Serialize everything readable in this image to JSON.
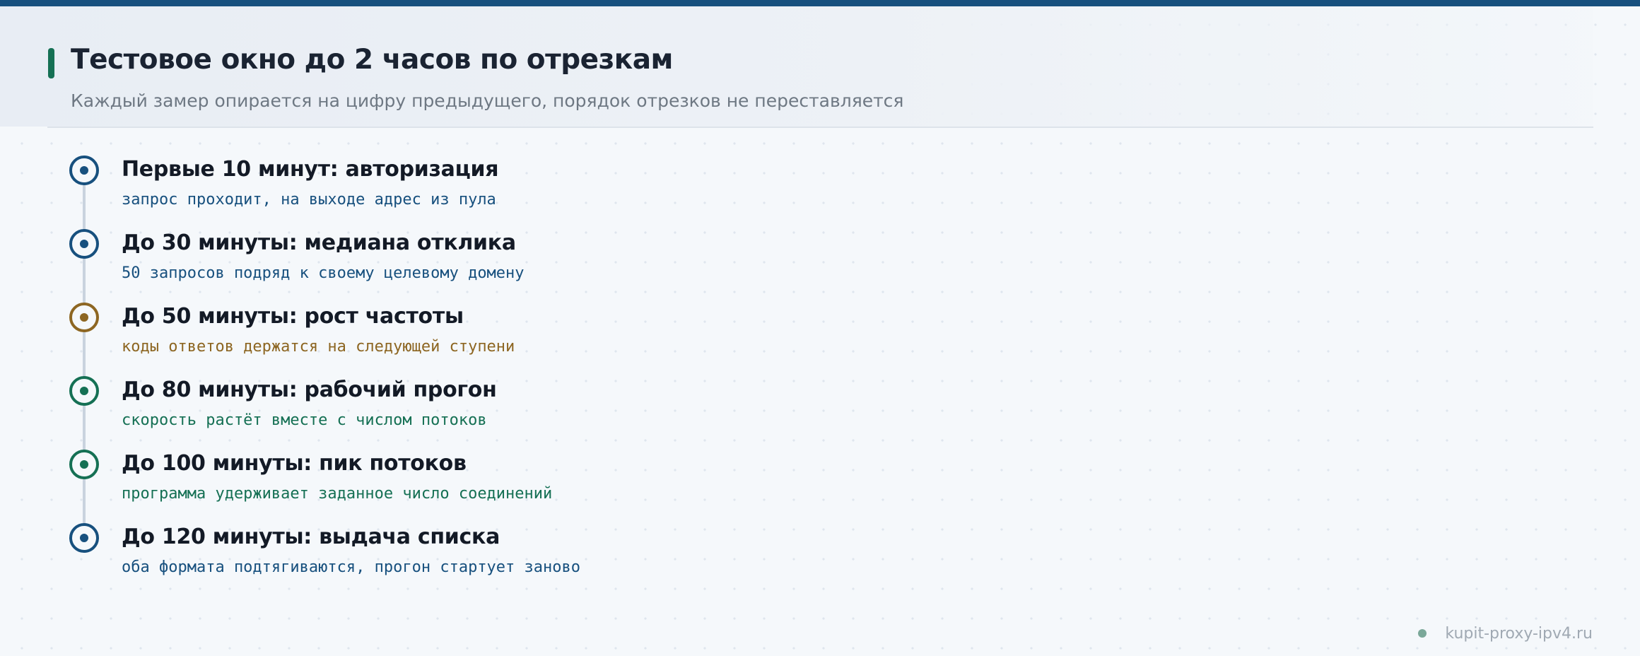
{
  "header": {
    "title": "Тестовое окно до 2 часов по отрезкам",
    "subtitle": "Каждый замер опирается на цифру предыдущего, порядок отрезков не переставляется"
  },
  "colors": {
    "blue": "#17507e",
    "gold": "#8d6622",
    "green": "#157054"
  },
  "milestones": [
    {
      "title": "Первые 10 минут: авторизация",
      "desc": "запрос проходит, на выходе адрес из пула",
      "color": "#17507e",
      "icon": "timeline-marker-icon"
    },
    {
      "title": "До 30 минуты: медиана отклика",
      "desc": "50 запросов подряд к своему целевому домену",
      "color": "#17507e",
      "icon": "timeline-marker-icon"
    },
    {
      "title": "До 50 минуты: рост частоты",
      "desc": "коды ответов держатся на следующей ступени",
      "color": "#8d6622",
      "icon": "timeline-marker-icon"
    },
    {
      "title": "До 80 минуты: рабочий прогон",
      "desc": "скорость растёт вместе с числом потоков",
      "color": "#157054",
      "icon": "timeline-marker-icon"
    },
    {
      "title": "До 100 минуты: пик потоков",
      "desc": "программа удерживает заданное число соединений",
      "color": "#157054",
      "icon": "timeline-marker-icon"
    },
    {
      "title": "До 120 минуты: выдача списка",
      "desc": "оба формата подтягиваются, прогон стартует заново",
      "color": "#17507e",
      "icon": "timeline-marker-icon"
    }
  ],
  "footer": {
    "site": "kupit-proxy-ipv4.ru"
  }
}
